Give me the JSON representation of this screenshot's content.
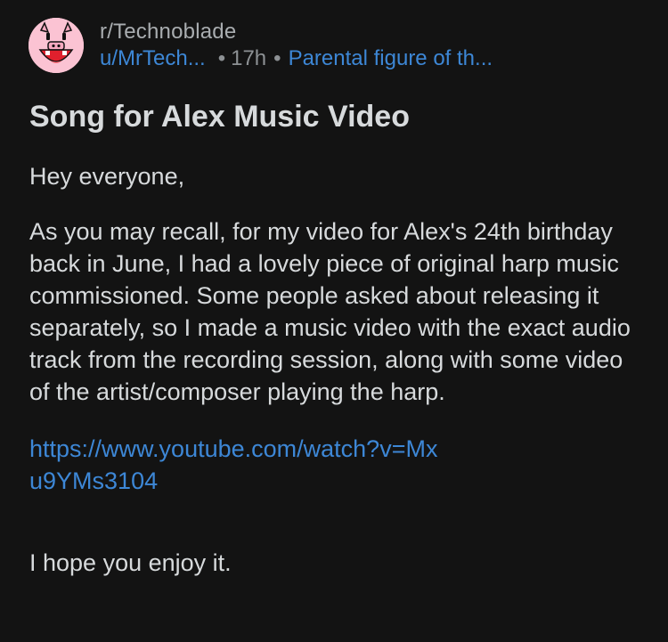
{
  "post": {
    "subreddit": "r/Technoblade",
    "username": "u/MrTech...",
    "separator": "•",
    "age": "17h",
    "flair": "Parental figure of th...",
    "title": "Song for Alex Music Video",
    "body": {
      "greeting": "Hey everyone,",
      "paragraph": "As you may recall, for my video for Alex's 24th birthday back in June, I had a lovely piece of original harp music commissioned. Some people asked about releasing it separately, so I made a music video with the exact audio track from the recording session, along with some video of the artist/composer playing the harp.",
      "link": "https://www.youtube.com/watch?v=Mxu9YMs3104",
      "closing": "I hope you enjoy it."
    }
  },
  "colors": {
    "background": "#131313",
    "text": "#d7dadc",
    "muted": "#a9adb0",
    "link": "#3d87d6",
    "avatar_bg": "#fbc3d3"
  },
  "icons": {
    "avatar": "pig-avatar-icon"
  }
}
